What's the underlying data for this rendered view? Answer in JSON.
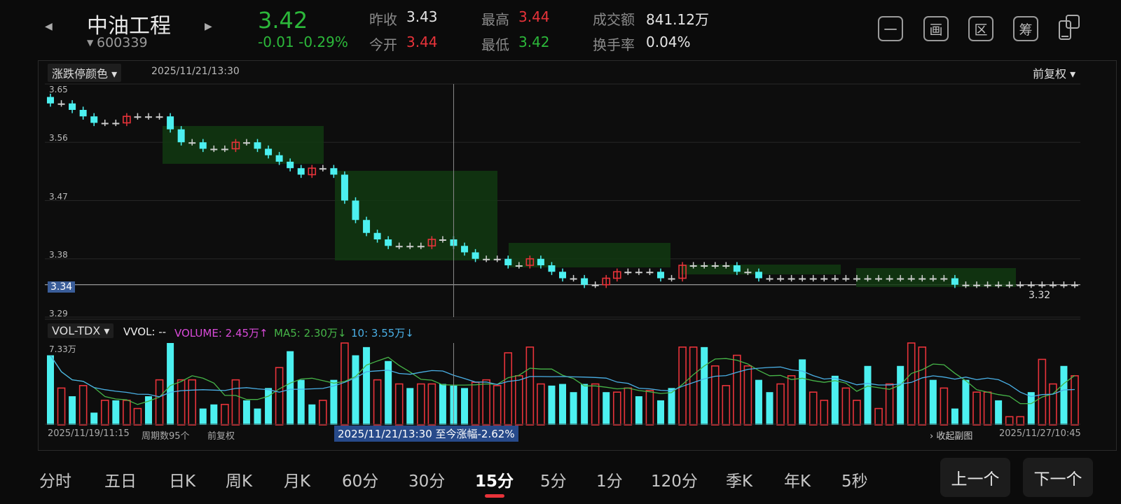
{
  "header": {
    "stock_name": "中油工程",
    "stock_code": "600339",
    "price": "3.42",
    "change": "-0.01",
    "change_pct": "-0.29%",
    "prev_close_label": "昨收",
    "prev_close": "3.43",
    "open_label": "今开",
    "open": "3.44",
    "high_label": "最高",
    "high": "3.44",
    "low_label": "最低",
    "low": "3.42",
    "turnover_label": "成交额",
    "turnover": "841.12万",
    "turnover_rate_label": "换手率",
    "turnover_rate": "0.04%",
    "tool_buttons": [
      "一",
      "画",
      "区",
      "筹"
    ]
  },
  "chart_header": {
    "color_mode": "涨跌停颜色",
    "crosshair_time": "2025/11/21/13:30",
    "adjust_mode": "前复权"
  },
  "volume_header": {
    "indicator": "VOL-TDX",
    "vvol": "VVOL: --",
    "volume": "VOLUME: 2.45万↑",
    "ma5": "MA5: 2.30万↓",
    "ma10": "10: 3.55万↓",
    "max_label": "7.33万"
  },
  "footer": {
    "start_time": "2025/11/19/11:15",
    "period_count": "周期数95个",
    "adjust": "前复权",
    "crosshair_info": "2025/11/21/13:30 至今涨幅-2.62%",
    "collapse": "收起副图",
    "end_time": "2025/11/27/10:45"
  },
  "colors": {
    "up": "#e8333a",
    "down": "#4cf0f0",
    "flat": "#cfcfcf",
    "box": "#123a12"
  },
  "chart_data": {
    "type": "candlestick",
    "y_ticks": [
      "3.65",
      "3.56",
      "3.47",
      "3.38",
      "3.29"
    ],
    "ylim": [
      3.29,
      3.65
    ],
    "last_price_label": "3.34",
    "min_label": "3.32",
    "period_count": 95,
    "crosshair_index": 37,
    "volume_max": 7.33
  },
  "timeframes": [
    "分时",
    "五日",
    "日K",
    "周K",
    "月K",
    "60分",
    "30分",
    "15分",
    "5分",
    "1分",
    "120分",
    "季K",
    "年K",
    "5秒"
  ],
  "active_timeframe": "15分",
  "nav": {
    "prev": "上一个",
    "next": "下一个"
  }
}
